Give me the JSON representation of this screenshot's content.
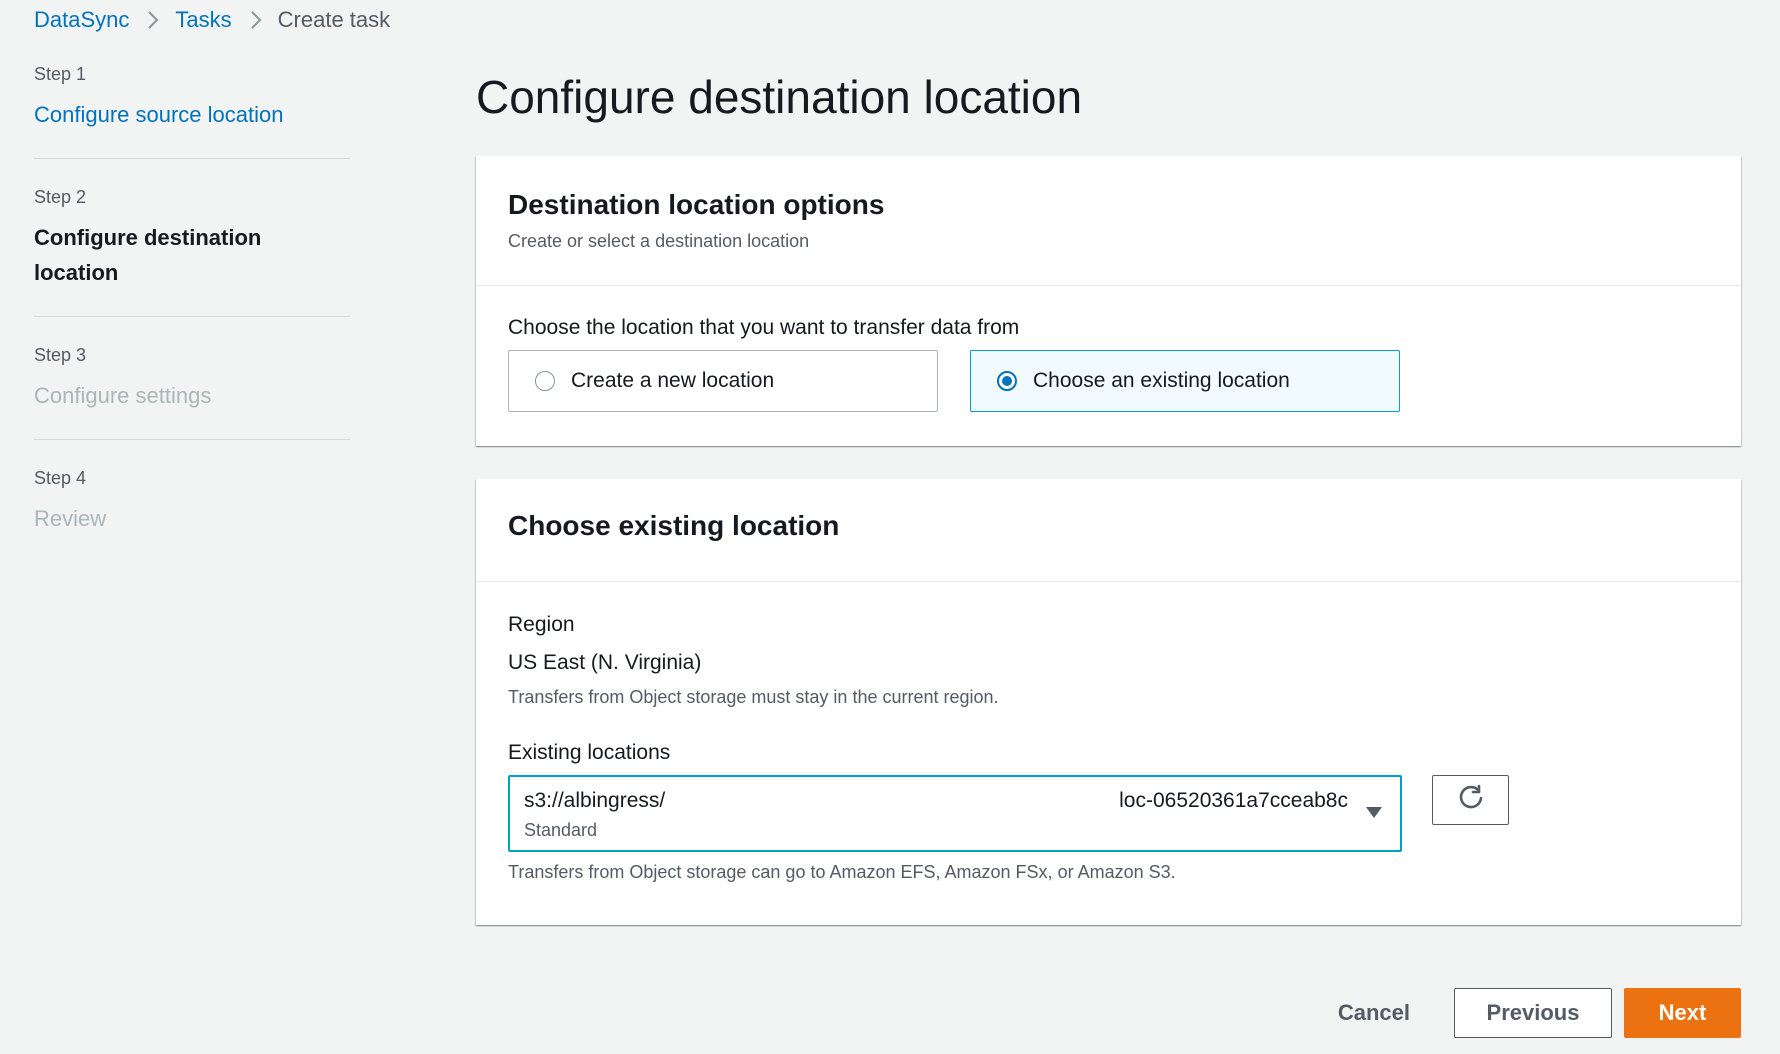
{
  "breadcrumb": {
    "items": [
      "DataSync",
      "Tasks"
    ],
    "current": "Create task"
  },
  "steps": [
    {
      "num": "Step 1",
      "title": "Configure source location",
      "state": "link"
    },
    {
      "num": "Step 2",
      "title": "Configure destination location",
      "state": "active"
    },
    {
      "num": "Step 3",
      "title": "Configure settings",
      "state": "disabled"
    },
    {
      "num": "Step 4",
      "title": "Review",
      "state": "disabled"
    }
  ],
  "page_title": "Configure destination location",
  "options_card": {
    "title": "Destination location options",
    "description": "Create or select a destination location",
    "prompt": "Choose the location that you want to transfer data from",
    "radios": [
      {
        "label": "Create a new location",
        "selected": false
      },
      {
        "label": "Choose an existing location",
        "selected": true
      }
    ]
  },
  "existing_card": {
    "title": "Choose existing location",
    "region_label": "Region",
    "region_value": "US East (N. Virginia)",
    "region_hint": "Transfers from Object storage must stay in the current region.",
    "locations_label": "Existing locations",
    "selected_location": {
      "uri": "s3://albingress/",
      "storage_class": "Standard",
      "id": "loc-06520361a7cceab8c"
    },
    "locations_hint": "Transfers from Object storage can go to Amazon EFS, Amazon FSx, or Amazon S3."
  },
  "footer": {
    "cancel": "Cancel",
    "previous": "Previous",
    "next": "Next"
  },
  "colors": {
    "link": "#0073bb",
    "primary": "#ec7211",
    "focus": "#00a1c9",
    "background": "#f2f3f3"
  },
  "icons": [
    "chevron-right-icon",
    "refresh-icon",
    "caret-down-icon"
  ]
}
